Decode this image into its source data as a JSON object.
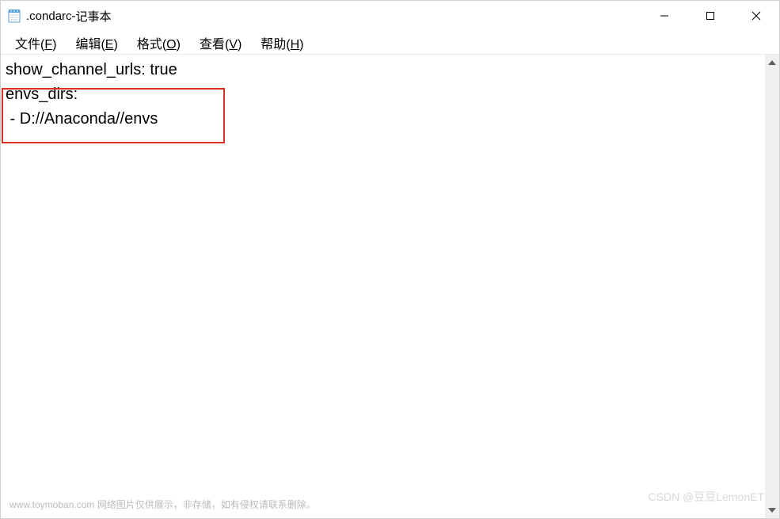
{
  "titlebar": {
    "filename": ".condarc",
    "app_name": "记事本",
    "separator": " - "
  },
  "menubar": {
    "file": {
      "label": "文件",
      "mnemonic": "F"
    },
    "edit": {
      "label": "编辑",
      "mnemonic": "E"
    },
    "format": {
      "label": "格式",
      "mnemonic": "O"
    },
    "view": {
      "label": "查看",
      "mnemonic": "V"
    },
    "help": {
      "label": "帮助",
      "mnemonic": "H"
    }
  },
  "content": {
    "line1": "show_channel_urls: true",
    "line2": "envs_dirs:",
    "line3": " - D://Anaconda//envs"
  },
  "watermark": {
    "bottom_left": "www.toymoban.com 网络图片仅供展示，非存储，如有侵权请联系删除。",
    "bottom_right": "CSDN @豆豆LemonET"
  }
}
